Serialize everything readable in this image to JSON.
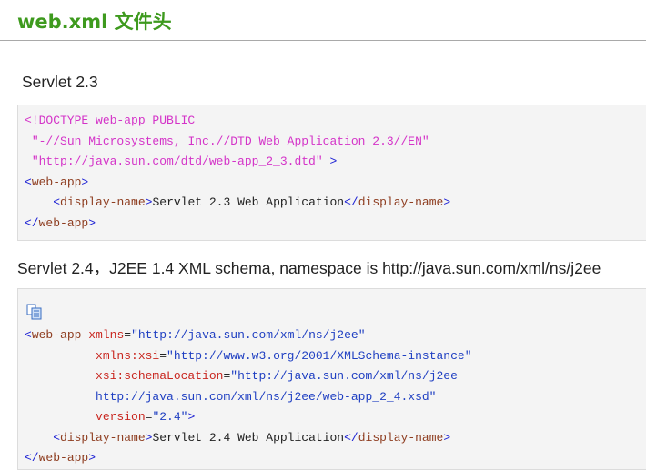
{
  "page": {
    "title": "web.xml 文件头",
    "section1_label": "Servlet 2.3",
    "section2_label": "Servlet 2.4，J2EE 1.4 XML schema, namespace is http://java.sun.com/xml/ns/j2ee"
  },
  "code1": {
    "doctype": "<!DOCTYPE web-app PUBLIC",
    "public_id": "\"-//Sun Microsystems, Inc.//DTD Web Application 2.3//EN\"",
    "system_id": "\"http://java.sun.com/dtd/web-app_2_3.dtd\"",
    "doctype_close": ">",
    "root_tag": "web-app",
    "display_tag": "display-name",
    "display_value": "Servlet 2.3 Web Application"
  },
  "code2": {
    "icon": "copy-icon",
    "root_tag": "web-app",
    "attr_xmlns": "xmlns",
    "val_xmlns": "\"http://java.sun.com/xml/ns/j2ee\"",
    "attr_xsi": "xmlns:xsi",
    "val_xsi": "\"http://www.w3.org/2001/XMLSchema-instance\"",
    "attr_schema": "xsi:schemaLocation",
    "val_schema_1": "\"http://java.sun.com/xml/ns/j2ee",
    "val_schema_2": "http://java.sun.com/xml/ns/j2ee/web-app_2_4.xsd\"",
    "attr_version": "version",
    "val_version": "\"2.4\"",
    "display_tag": "display-name",
    "display_value": "Servlet 2.4 Web Application"
  },
  "colors": {
    "title": "#3e9a1e",
    "bracket": "#1c20d4",
    "tag": "#8e3d20",
    "doctype": "#d433c8",
    "attribute": "#c9261f",
    "string": "#1f3fc2"
  }
}
